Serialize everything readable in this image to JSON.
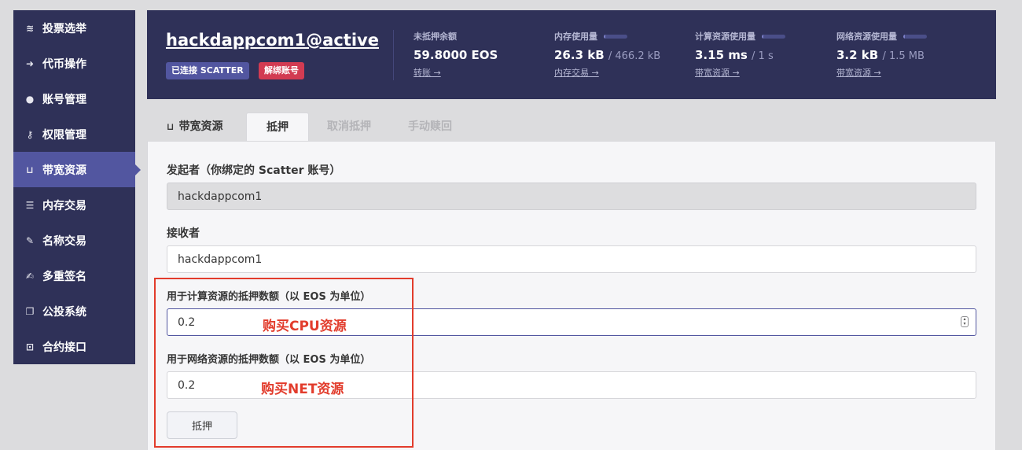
{
  "sidebar": {
    "items": [
      {
        "label": "投票选举",
        "icon": "stack-icon",
        "glyph": "≋"
      },
      {
        "label": "代币操作",
        "icon": "arrow-icon",
        "glyph": "➜"
      },
      {
        "label": "账号管理",
        "icon": "user-icon",
        "glyph": "●"
      },
      {
        "label": "权限管理",
        "icon": "key-icon",
        "glyph": "⚷"
      },
      {
        "label": "带宽资源",
        "icon": "inbox-icon",
        "glyph": "⊔"
      },
      {
        "label": "内存交易",
        "icon": "memory-icon",
        "glyph": "☰"
      },
      {
        "label": "名称交易",
        "icon": "pen-icon",
        "glyph": "✎"
      },
      {
        "label": "多重签名",
        "icon": "signature-icon",
        "glyph": "✍"
      },
      {
        "label": "公投系统",
        "icon": "comments-icon",
        "glyph": "❐"
      },
      {
        "label": "合约接口",
        "icon": "robot-icon",
        "glyph": "⊡"
      }
    ],
    "active_index": 4
  },
  "header": {
    "account": "hackdappcom1@active",
    "badge_connected": "已连接 SCATTER",
    "badge_unbind": "解绑账号",
    "stats": [
      {
        "label": "未抵押余额",
        "value": "59.8000 EOS",
        "total": "",
        "link": "转账 →"
      },
      {
        "label": "内存使用量",
        "value": "26.3 kB",
        "total": "/ 466.2 kB",
        "link": "内存交易 →",
        "usage": 0.06
      },
      {
        "label": "计算资源使用量",
        "value": "3.15 ms",
        "total": "/ 1 s",
        "link": "带宽资源 →",
        "usage": 0.003
      },
      {
        "label": "网络资源使用量",
        "value": "3.2 kB",
        "total": "/ 1.5 MB",
        "link": "带宽资源 →",
        "usage": 0.002
      }
    ]
  },
  "tabs": [
    {
      "label": "带宽资源",
      "icon": "inbox-icon",
      "glyph": "⊔"
    },
    {
      "label": "抵押"
    },
    {
      "label": "取消抵押"
    },
    {
      "label": "手动赎回"
    }
  ],
  "active_tab": 1,
  "form": {
    "sender_label": "发起者（你绑定的 Scatter 账号）",
    "sender_value": "hackdappcom1",
    "receiver_label": "接收者",
    "receiver_value": "hackdappcom1",
    "cpu_label": "用于计算资源的抵押数额（以 EOS 为单位）",
    "cpu_value": "0.2",
    "net_label": "用于网络资源的抵押数额（以 EOS 为单位）",
    "net_value": "0.2",
    "submit_label": "抵押"
  },
  "annotations": {
    "cpu_note": "购买CPU资源",
    "net_note": "购买NET资源",
    "color": "#e23c2c"
  },
  "colors": {
    "navy": "#2f3158",
    "accent": "#5256a0",
    "danger": "#d23b52"
  }
}
